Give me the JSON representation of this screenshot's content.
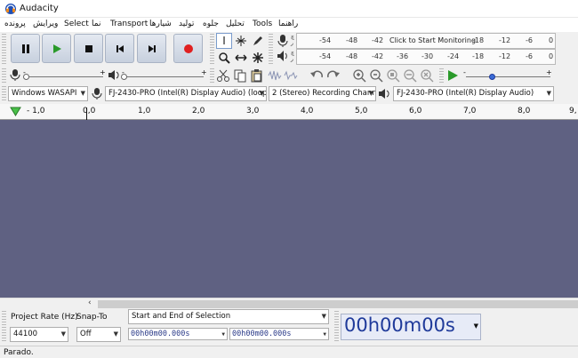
{
  "window": {
    "title": "Audacity"
  },
  "menu": {
    "items": [
      "پرونده",
      "ویرایش",
      "Select",
      "نما",
      "Transport",
      "شیارها",
      "تولید",
      "جلوه",
      "تحلیل",
      "Tools",
      "راهنما"
    ]
  },
  "meters": {
    "record_ticks": [
      "-54",
      "-48",
      "-42",
      "-18",
      "-12",
      "-6",
      "0"
    ],
    "record_message": "Click to Start Monitoring",
    "play_ticks": [
      "-54",
      "-48",
      "-42",
      "-36",
      "-30",
      "-24",
      "-18",
      "-12",
      "-6",
      "0"
    ],
    "left_channel": "چ",
    "right_channel": "ر"
  },
  "devices": {
    "host": "Windows WASAPI",
    "recording_device": "FJ-2430-PRO (Intel(R) Display Audio) (loopbac",
    "recording_channels": "2 (Stereo) Recording Chann",
    "playback_device": "FJ-2430-PRO (Intel(R) Display Audio)"
  },
  "ruler": {
    "labels": [
      "- 1,0",
      "0,0",
      "1,0",
      "2,0",
      "3,0",
      "4,0",
      "5,0",
      "6,0",
      "7,0",
      "8,0",
      "9,"
    ]
  },
  "selection": {
    "project_rate_label": "Project Rate (Hz)",
    "project_rate_value": "44100",
    "snap_to_label": "Snap-To",
    "snap_to_value": "Off",
    "selection_mode": "Start and End of Selection",
    "start_time": "00h00m00.000s",
    "end_time": "00h00m00.000s",
    "audio_position": "00h00m00s"
  },
  "status": {
    "text": "Parado."
  },
  "colors": {
    "track_background": "#5f6182",
    "record_red": "#e02020",
    "play_green": "#2a9a2a"
  }
}
